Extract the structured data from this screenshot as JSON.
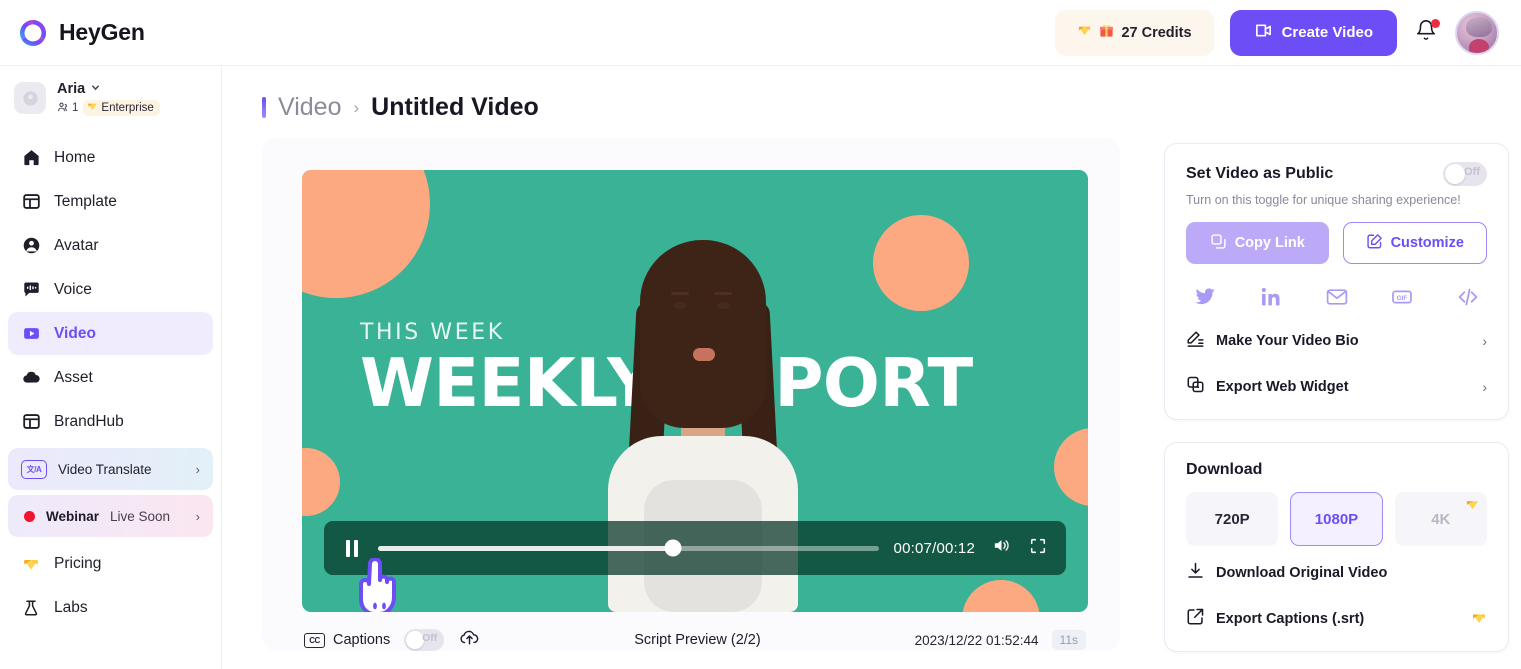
{
  "brand": {
    "name": "HeyGen"
  },
  "topbar": {
    "credits_label": "27 Credits",
    "create_label": "Create Video",
    "notification_icon": "bell-icon",
    "avatar_icon": "user-avatar"
  },
  "sidebar": {
    "workspace": {
      "name": "Aria",
      "member_count": "1",
      "plan": "Enterprise"
    },
    "items": [
      {
        "label": "Home",
        "icon": "home-icon",
        "active": false
      },
      {
        "label": "Template",
        "icon": "template-icon",
        "active": false
      },
      {
        "label": "Avatar",
        "icon": "avatar-icon",
        "active": false
      },
      {
        "label": "Voice",
        "icon": "voice-icon",
        "active": false
      },
      {
        "label": "Video",
        "icon": "video-icon",
        "active": true
      },
      {
        "label": "Asset",
        "icon": "cloud-icon",
        "active": false
      },
      {
        "label": "BrandHub",
        "icon": "brandhub-icon",
        "active": false
      }
    ],
    "promos": [
      {
        "label": "Video Translate",
        "icon": "translate-badge-icon"
      },
      {
        "label_strong": "Webinar",
        "label_rest": "Live Soon",
        "icon": "live-dot-icon"
      }
    ],
    "footer_items": [
      {
        "label": "Pricing",
        "icon": "gem-icon"
      },
      {
        "label": "Labs",
        "icon": "flask-icon"
      }
    ]
  },
  "breadcrumb": {
    "parent": "Video",
    "separator": "›",
    "current": "Untitled Video"
  },
  "video": {
    "overlay_small": "THIS WEEK",
    "overlay_big": "WEEKLY REPORT",
    "current_time": "00:07",
    "total_time": "00:12",
    "time_display": "00:07/00:12",
    "progress_percent": 59,
    "play_state": "playing",
    "background_color": "#39b295",
    "accent_shape_color": "#fca982"
  },
  "undercard": {
    "captions_badge": "CC",
    "captions_label": "Captions",
    "captions_toggle": "Off",
    "upload_icon": "upload-cloud-icon",
    "script_preview": "Script Preview (2/2)",
    "timestamp": "2023/12/22 01:52:44",
    "duration": "11s"
  },
  "share_panel": {
    "title": "Set Video as Public",
    "toggle_state": "Off",
    "subtitle": "Turn on this toggle for unique sharing experience!",
    "copy_link_label": "Copy Link",
    "customize_label": "Customize",
    "social_icons": [
      "twitter-icon",
      "linkedin-icon",
      "email-icon",
      "gif-icon",
      "embed-code-icon"
    ],
    "links": [
      {
        "label": "Make Your Video Bio",
        "icon": "video-bio-icon",
        "chevron": "›"
      },
      {
        "label": "Export Web Widget",
        "icon": "web-widget-icon",
        "chevron": "›"
      }
    ]
  },
  "download_panel": {
    "title": "Download",
    "resolutions": [
      {
        "label": "720P",
        "state": "normal",
        "premium": false
      },
      {
        "label": "1080P",
        "state": "selected",
        "premium": false
      },
      {
        "label": "4K",
        "state": "disabled",
        "premium": true
      }
    ],
    "actions": [
      {
        "label": "Download Original Video",
        "icon": "download-icon",
        "premium": false
      },
      {
        "label": "Export Captions (.srt)",
        "icon": "external-link-icon",
        "premium": true
      }
    ]
  },
  "colors": {
    "accent": "#6c4df6",
    "accent_light": "#bcaaf8",
    "video_bg": "#39b295",
    "shape": "#fca982",
    "danger": "#f0142f"
  }
}
